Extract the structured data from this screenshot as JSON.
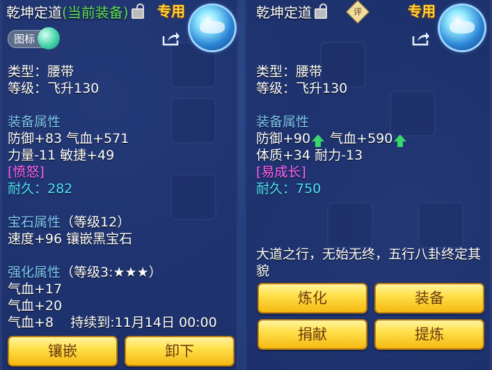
{
  "left": {
    "title_main": "乾坤定道",
    "title_status": "(当前装备)",
    "exclusive": "专用",
    "icon_chip": "图标",
    "type_line": "类型：腰带",
    "level_line": "等级：飞升130",
    "attr_header": "装备属性",
    "attr1": "防御+83 气血+571",
    "attr2": "力量-11 敏捷+49",
    "special": "[愤怒]",
    "durability": "耐久：282",
    "gem_header": "宝石属性",
    "gem_level": "（等级12）",
    "gem_line": "速度+96 镶嵌黑宝石",
    "enh_header": "强化属性",
    "enh_level": "（等级3:★★★）",
    "enh1": "气血+17",
    "enh2": "气血+20",
    "enh3": "气血+8",
    "enh3_duration": "持续到:11月14日 00:00",
    "buttons": [
      "镶嵌",
      "卸下"
    ]
  },
  "right": {
    "title_main": "乾坤定道",
    "eval_icon": "评",
    "exclusive": "专用",
    "type_line": "类型：腰带",
    "level_line": "等级：飞升130",
    "attr_header": "装备属性",
    "attr1a": "防御+90",
    "attr1b": "气血+590",
    "attr2": "体质+34 耐力-13",
    "special": "[易成长]",
    "durability": "耐久：750",
    "desc": "大道之行，无始无终，五行八卦终定其貌",
    "buttons": [
      "炼化",
      "装备",
      "捐献",
      "提炼"
    ]
  },
  "colors": {
    "status_green": "#5fe05a",
    "header_blue": "#7ec8ff",
    "special_purple": "#ff66ff",
    "durability_cyan": "#4fe3ff",
    "button_gold": "#ffe04a",
    "exclusive_gold": "#ffd23a"
  },
  "icons": [
    "lock-icon",
    "share-icon",
    "gem-orb-icon",
    "item-emblem-icon",
    "up-arrow-icon"
  ]
}
